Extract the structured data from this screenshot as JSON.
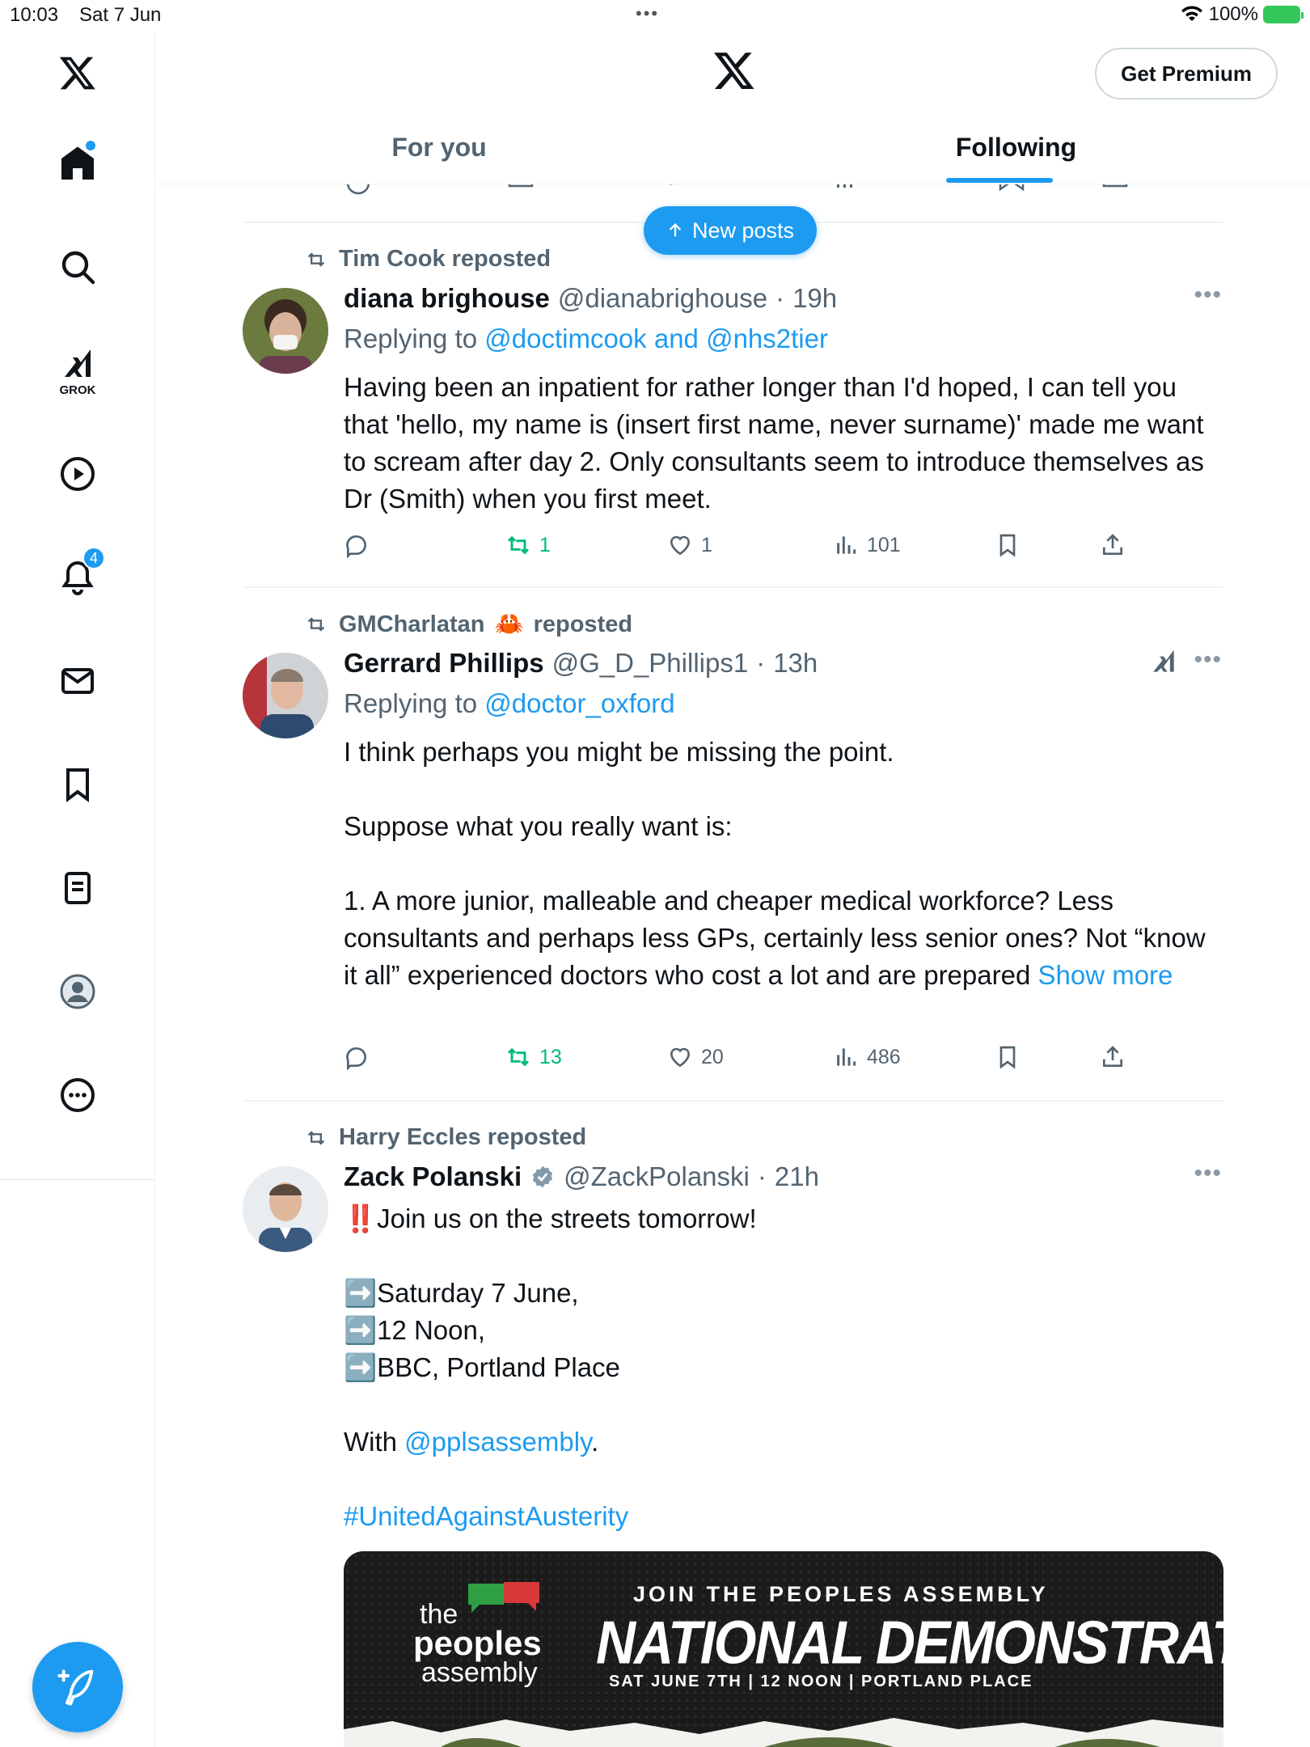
{
  "status_bar": {
    "time": "10:03",
    "date": "Sat 7 Jun",
    "battery": "100%"
  },
  "header": {
    "premium_label": "Get Premium",
    "tabs": [
      {
        "label": "For you"
      },
      {
        "label": "Following"
      }
    ],
    "new_posts_label": "New posts"
  },
  "sidebar": {
    "grok_label": "GROK",
    "notifications_count": "4"
  },
  "tweets": [
    {
      "repost_by": "Tim Cook reposted",
      "name": "diana brighouse",
      "handle": "@dianabrighouse",
      "time": "19h",
      "replying_prefix": "Replying to",
      "replying_to": "@doctimcook and @nhs2tier",
      "body": [
        "Having been an inpatient for rather longer than I'd hoped, I can tell you that 'hello, my name is (insert first name, never surname)' made me want to scream after day 2. Only consultants seem to introduce themselves as Dr (Smith) when you first meet."
      ],
      "stats": {
        "retweets": "1",
        "likes": "1",
        "views": "101"
      }
    },
    {
      "repost_by": "GMCharlatan",
      "repost_emoji": "🦀",
      "repost_suffix": "reposted",
      "name": "Gerrard Phillips",
      "handle": "@G_D_Phillips1",
      "time": "13h",
      "replying_prefix": "Replying to",
      "replying_to": "@doctor_oxford",
      "body": [
        "I think perhaps you might be missing the point.",
        "Suppose what you really want is:",
        "1. A more junior, malleable and cheaper medical workforce? Less consultants and perhaps less GPs, certainly less senior ones? Not “know it all” experienced doctors who cost a lot and are prepared"
      ],
      "show_more": "Show more",
      "stats": {
        "retweets": "13",
        "likes": "20",
        "views": "486"
      }
    },
    {
      "repost_by": "Harry Eccles reposted",
      "name": "Zack Polanski",
      "handle": "@ZackPolanski",
      "time": "21h",
      "lines": [
        "‼️Join us on the streets tomorrow!",
        "➡️Saturday 7 June,",
        "➡️12 Noon,",
        "➡️BBC, Portland Place",
        "With",
        "@pplsassembly",
        ".",
        "#UnitedAgainstAusterity"
      ],
      "media": {
        "top_line": "JOIN THE PEOPLES ASSEMBLY",
        "headline": "NATIONAL DEMONSTRATION",
        "sub_line": "SAT JUNE 7TH | 12 NOON | PORTLAND PLACE",
        "logo_the": "the",
        "logo_peoples": "peoples",
        "logo_assembly": "assembly"
      }
    }
  ],
  "colors": {
    "accent": "#1d9bf0",
    "retweet_green": "#00ba7c",
    "muted": "#536471"
  }
}
